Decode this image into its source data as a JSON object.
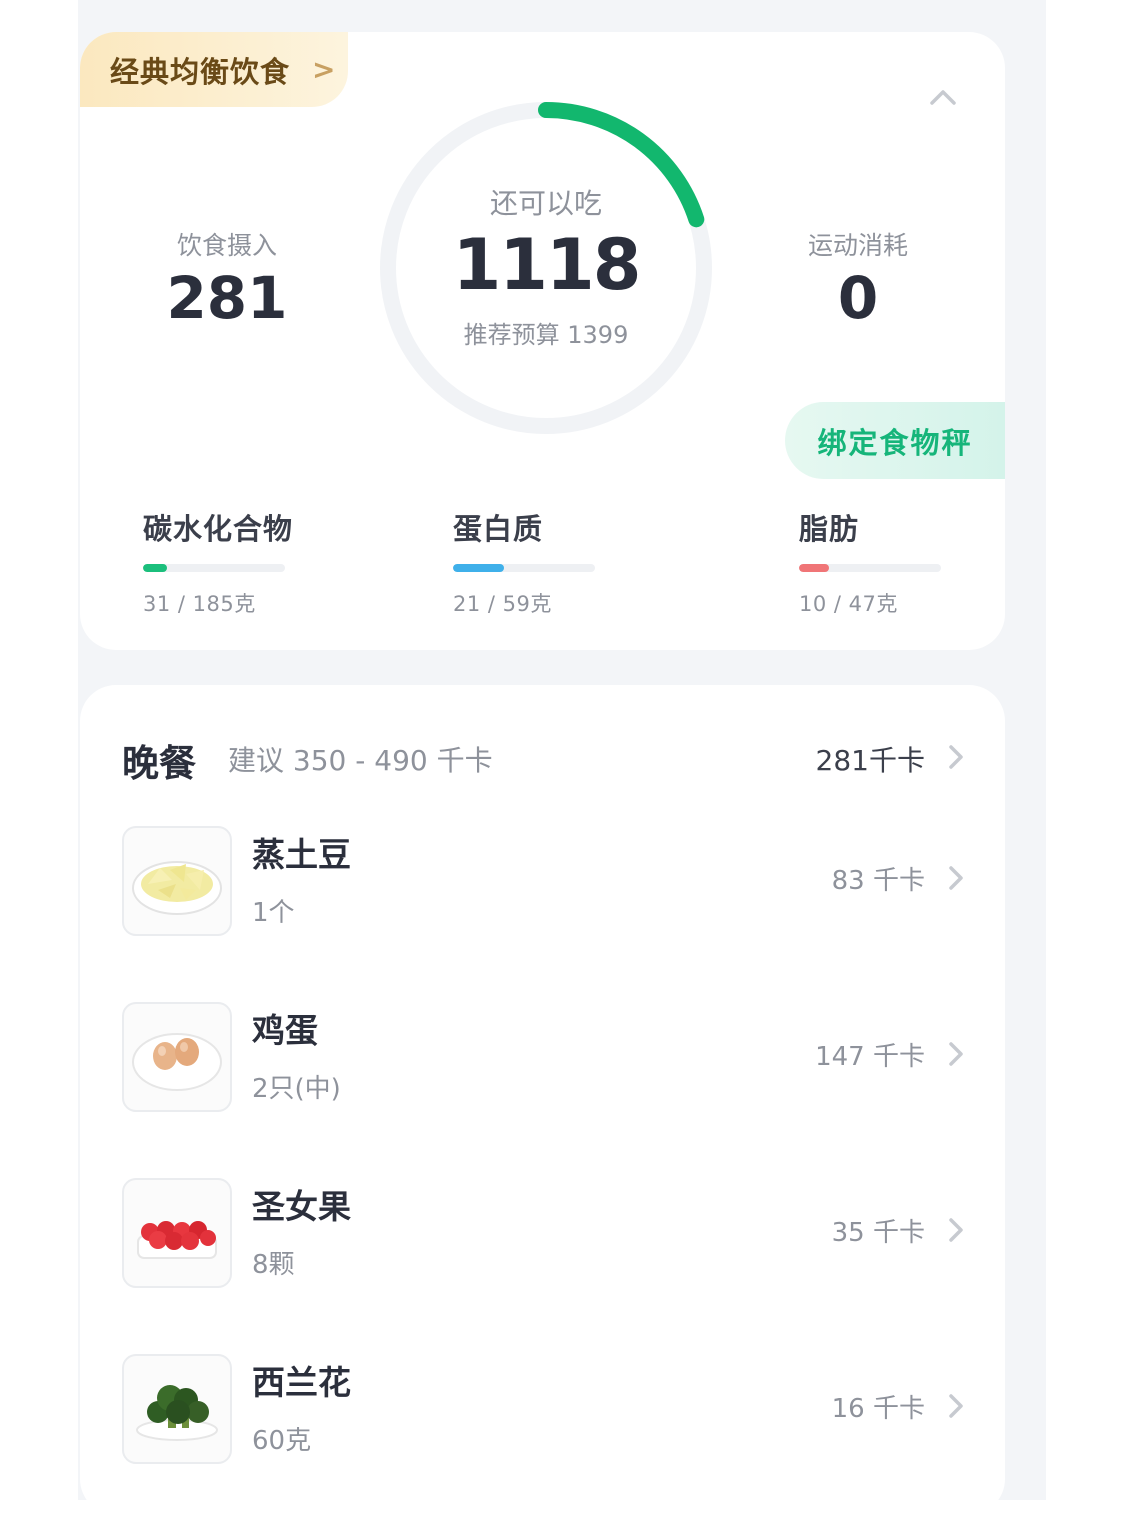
{
  "summary": {
    "diet_plan_label": "经典均衡饮食",
    "intake": {
      "label": "饮食摄入",
      "value": "281"
    },
    "remaining": {
      "label": "还可以吃",
      "value": "1118",
      "budget_text": "推荐预算 1399",
      "ring_progress_fraction": 0.2
    },
    "exercise": {
      "label": "运动消耗",
      "value": "0"
    },
    "scale_button_label": "绑定食物秤",
    "macros": [
      {
        "name": "碳水化合物",
        "amount": "31 / 185克",
        "fraction": 0.168,
        "color": "#1bbf7c"
      },
      {
        "name": "蛋白质",
        "amount": "21 / 59克",
        "fraction": 0.356,
        "color": "#3fb0ea"
      },
      {
        "name": "脂肪",
        "amount": "10 / 47克",
        "fraction": 0.213,
        "color": "#f07577"
      }
    ],
    "colors": {
      "ring_progress": "#12b76e",
      "ring_track": "#f1f3f6"
    }
  },
  "meal": {
    "title": "晚餐",
    "suggestion": "建议 350 - 490 千卡",
    "total": "281千卡",
    "items": [
      {
        "name": "蒸土豆",
        "quantity": "1个",
        "calories": "83 千卡",
        "icon": "steamed-potato-image"
      },
      {
        "name": "鸡蛋",
        "quantity": "2只(中)",
        "calories": "147 千卡",
        "icon": "eggs-image"
      },
      {
        "name": "圣女果",
        "quantity": "8颗",
        "calories": "35 千卡",
        "icon": "cherry-tomatoes-image"
      },
      {
        "name": "西兰花",
        "quantity": "60克",
        "calories": "16 千卡",
        "icon": "broccoli-image"
      }
    ]
  }
}
